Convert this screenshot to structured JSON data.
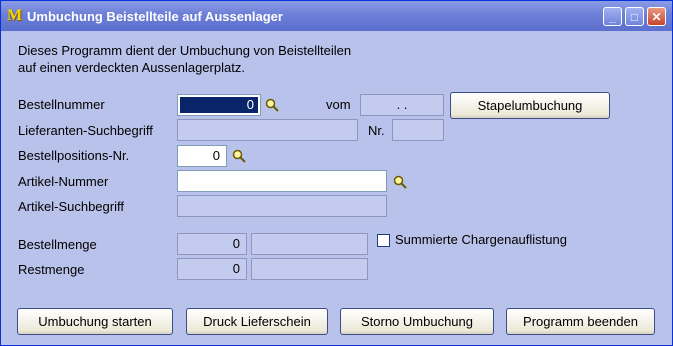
{
  "window": {
    "title": "Umbuchung Beistellteile auf Aussenlager",
    "logo_letter": "M",
    "controls": {
      "minimize": "_",
      "maximize": "□",
      "close": "✕"
    }
  },
  "intro": {
    "line1": "Dieses Programm dient der Umbuchung von Beistellteilen",
    "line2": "auf einen verdeckten Aussenlagerplatz."
  },
  "form": {
    "bestellnummer": {
      "label": "Bestellnummer",
      "value": "0",
      "vom_label": "vom",
      "vom_value": ". ."
    },
    "lieferanten": {
      "label": "Lieferanten-Suchbegriff",
      "value": "",
      "nr_label": "Nr.",
      "nr_value": ""
    },
    "bestellposition": {
      "label": "Bestellpositions-Nr.",
      "value": "0"
    },
    "artikel_nummer": {
      "label": "Artikel-Nummer",
      "value": ""
    },
    "artikel_suchbegriff": {
      "label": "Artikel-Suchbegriff",
      "value": ""
    },
    "bestellmenge": {
      "label": "Bestellmenge",
      "value": "0",
      "unit": ""
    },
    "restmenge": {
      "label": "Restmenge",
      "value": "0",
      "unit": ""
    },
    "summierte": {
      "label": "Summierte Chargenauflistung",
      "checked": false
    }
  },
  "buttons": {
    "stapel": "Stapelumbuchung",
    "umbuchung_starten": "Umbuchung starten",
    "druck_lieferschein": "Druck Lieferschein",
    "storno_umbuchung": "Storno Umbuchung",
    "programm_beenden": "Programm beenden"
  },
  "icons": {
    "search": "magnifier-icon"
  },
  "colors": {
    "titlebar": "#6d7fd6",
    "client": "#b9c2ea",
    "selection": "#0a246a"
  }
}
